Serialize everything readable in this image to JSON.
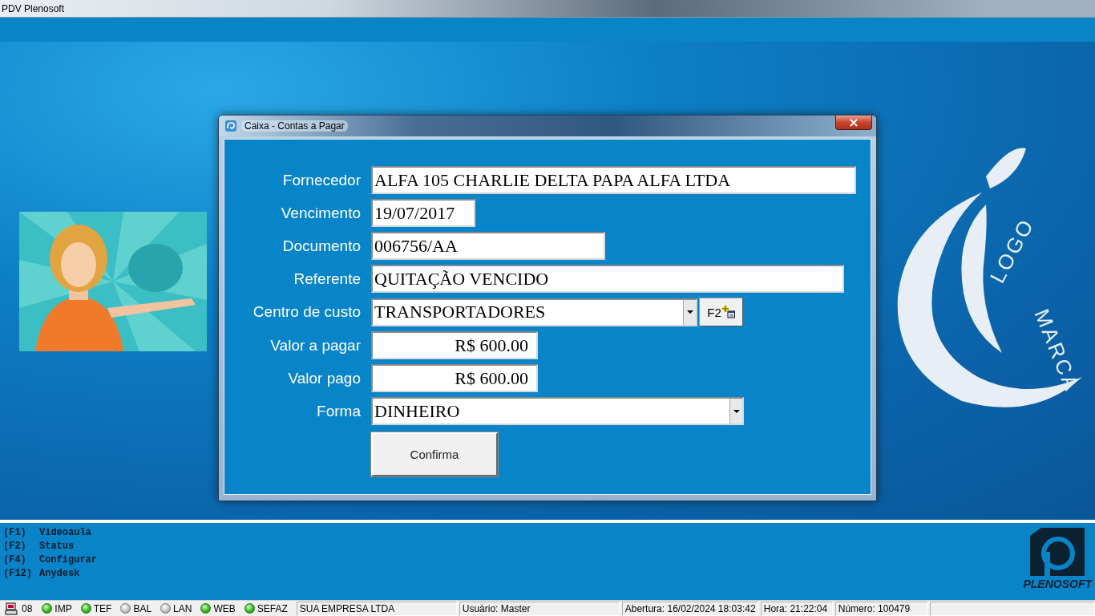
{
  "app_title": "PDV Plenosoft",
  "dialog": {
    "title": "Caixa - Contas a Pagar",
    "fields": [
      {
        "label": "Fornecedor",
        "value": "ALFA 105 CHARLIE DELTA PAPA ALFA LTDA",
        "kind": "text"
      },
      {
        "label": "Vencimento",
        "value": "19/07/2017",
        "kind": "text"
      },
      {
        "label": "Documento",
        "value": "006756/AA",
        "kind": "text"
      },
      {
        "label": "Referente",
        "value": "QUITAÇÃO VENCIDO",
        "kind": "text"
      },
      {
        "label": "Centro de custo",
        "value": "TRANSPORTADORES",
        "kind": "combo",
        "button": "F2"
      },
      {
        "label": "Valor a pagar",
        "value": "R$ 600.00",
        "kind": "money"
      },
      {
        "label": "Valor pago",
        "value": "R$ 600.00",
        "kind": "money"
      },
      {
        "label": "Forma",
        "value": "DINHEIRO",
        "kind": "combo"
      }
    ],
    "confirm": "Confirma"
  },
  "logo": {
    "words": [
      "LOGO",
      "MARCA"
    ]
  },
  "shortcuts": [
    {
      "key": "(F1)",
      "label": "Videoaula"
    },
    {
      "key": "(F2)",
      "label": "Status"
    },
    {
      "key": "(F4)",
      "label": "Configurar"
    },
    {
      "key": "(F12)",
      "label": "Anydesk"
    }
  ],
  "brand": "PLENOSOFT",
  "status_bar": {
    "terminal": "08",
    "indicators": [
      {
        "label": "IMP",
        "on": true
      },
      {
        "label": "TEF",
        "on": true
      },
      {
        "label": "BAL",
        "on": false
      },
      {
        "label": "LAN",
        "on": false
      },
      {
        "label": "WEB",
        "on": true
      },
      {
        "label": "SEFAZ",
        "on": true
      }
    ],
    "panels": [
      "SUA EMPRESA LTDA",
      "Usuário: Master",
      "Abertura: 16/02/2024 18:03:42",
      "Hora: 21:22:04",
      "Número: 100479"
    ]
  }
}
